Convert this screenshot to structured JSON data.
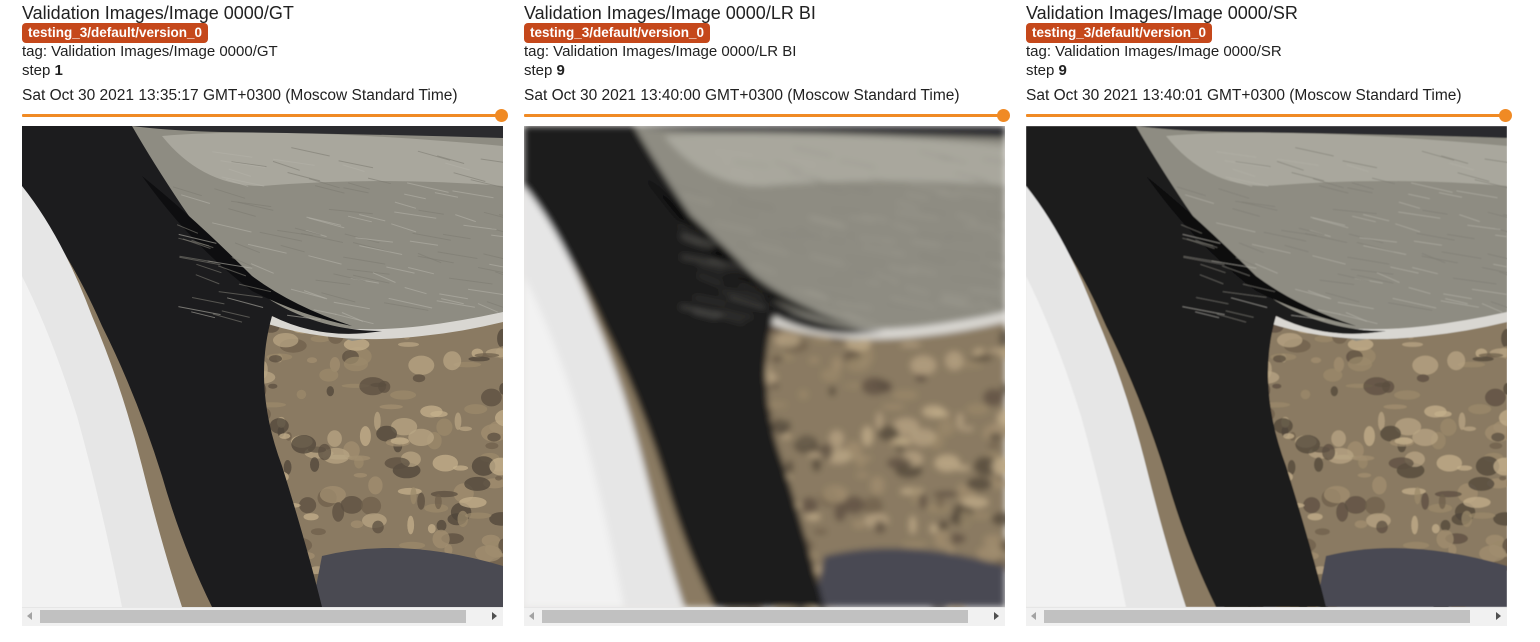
{
  "theme": {
    "run_chip_color": "#c5481b",
    "slider_color": "#f08a24"
  },
  "cards": [
    {
      "title": "Validation Images/Image 0000/GT",
      "run": "testing_3/default/version_0",
      "tag_text": "tag: Validation Images/Image 0000/GT",
      "step_label": "step",
      "step_value": "1",
      "timestamp": "Sat Oct 30 2021 13:35:17 GMT+0300 (Moscow Standard Time)",
      "image_variant": "GT",
      "image_blur": 0,
      "step_slider_position": 1.0
    },
    {
      "title": "Validation Images/Image 0000/LR BI",
      "run": "testing_3/default/version_0",
      "tag_text": "tag: Validation Images/Image 0000/LR BI",
      "step_label": "step",
      "step_value": "9",
      "timestamp": "Sat Oct 30 2021 13:40:00 GMT+0300 (Moscow Standard Time)",
      "image_variant": "LR BI",
      "image_blur": 3.2,
      "step_slider_position": 1.0
    },
    {
      "title": "Validation Images/Image 0000/SR",
      "run": "testing_3/default/version_0",
      "tag_text": "tag: Validation Images/Image 0000/SR",
      "step_label": "step",
      "step_value": "9",
      "timestamp": "Sat Oct 30 2021 13:40:01 GMT+0300 (Moscow Standard Time)",
      "image_variant": "SR",
      "image_blur": 0.6,
      "step_slider_position": 1.0
    }
  ]
}
